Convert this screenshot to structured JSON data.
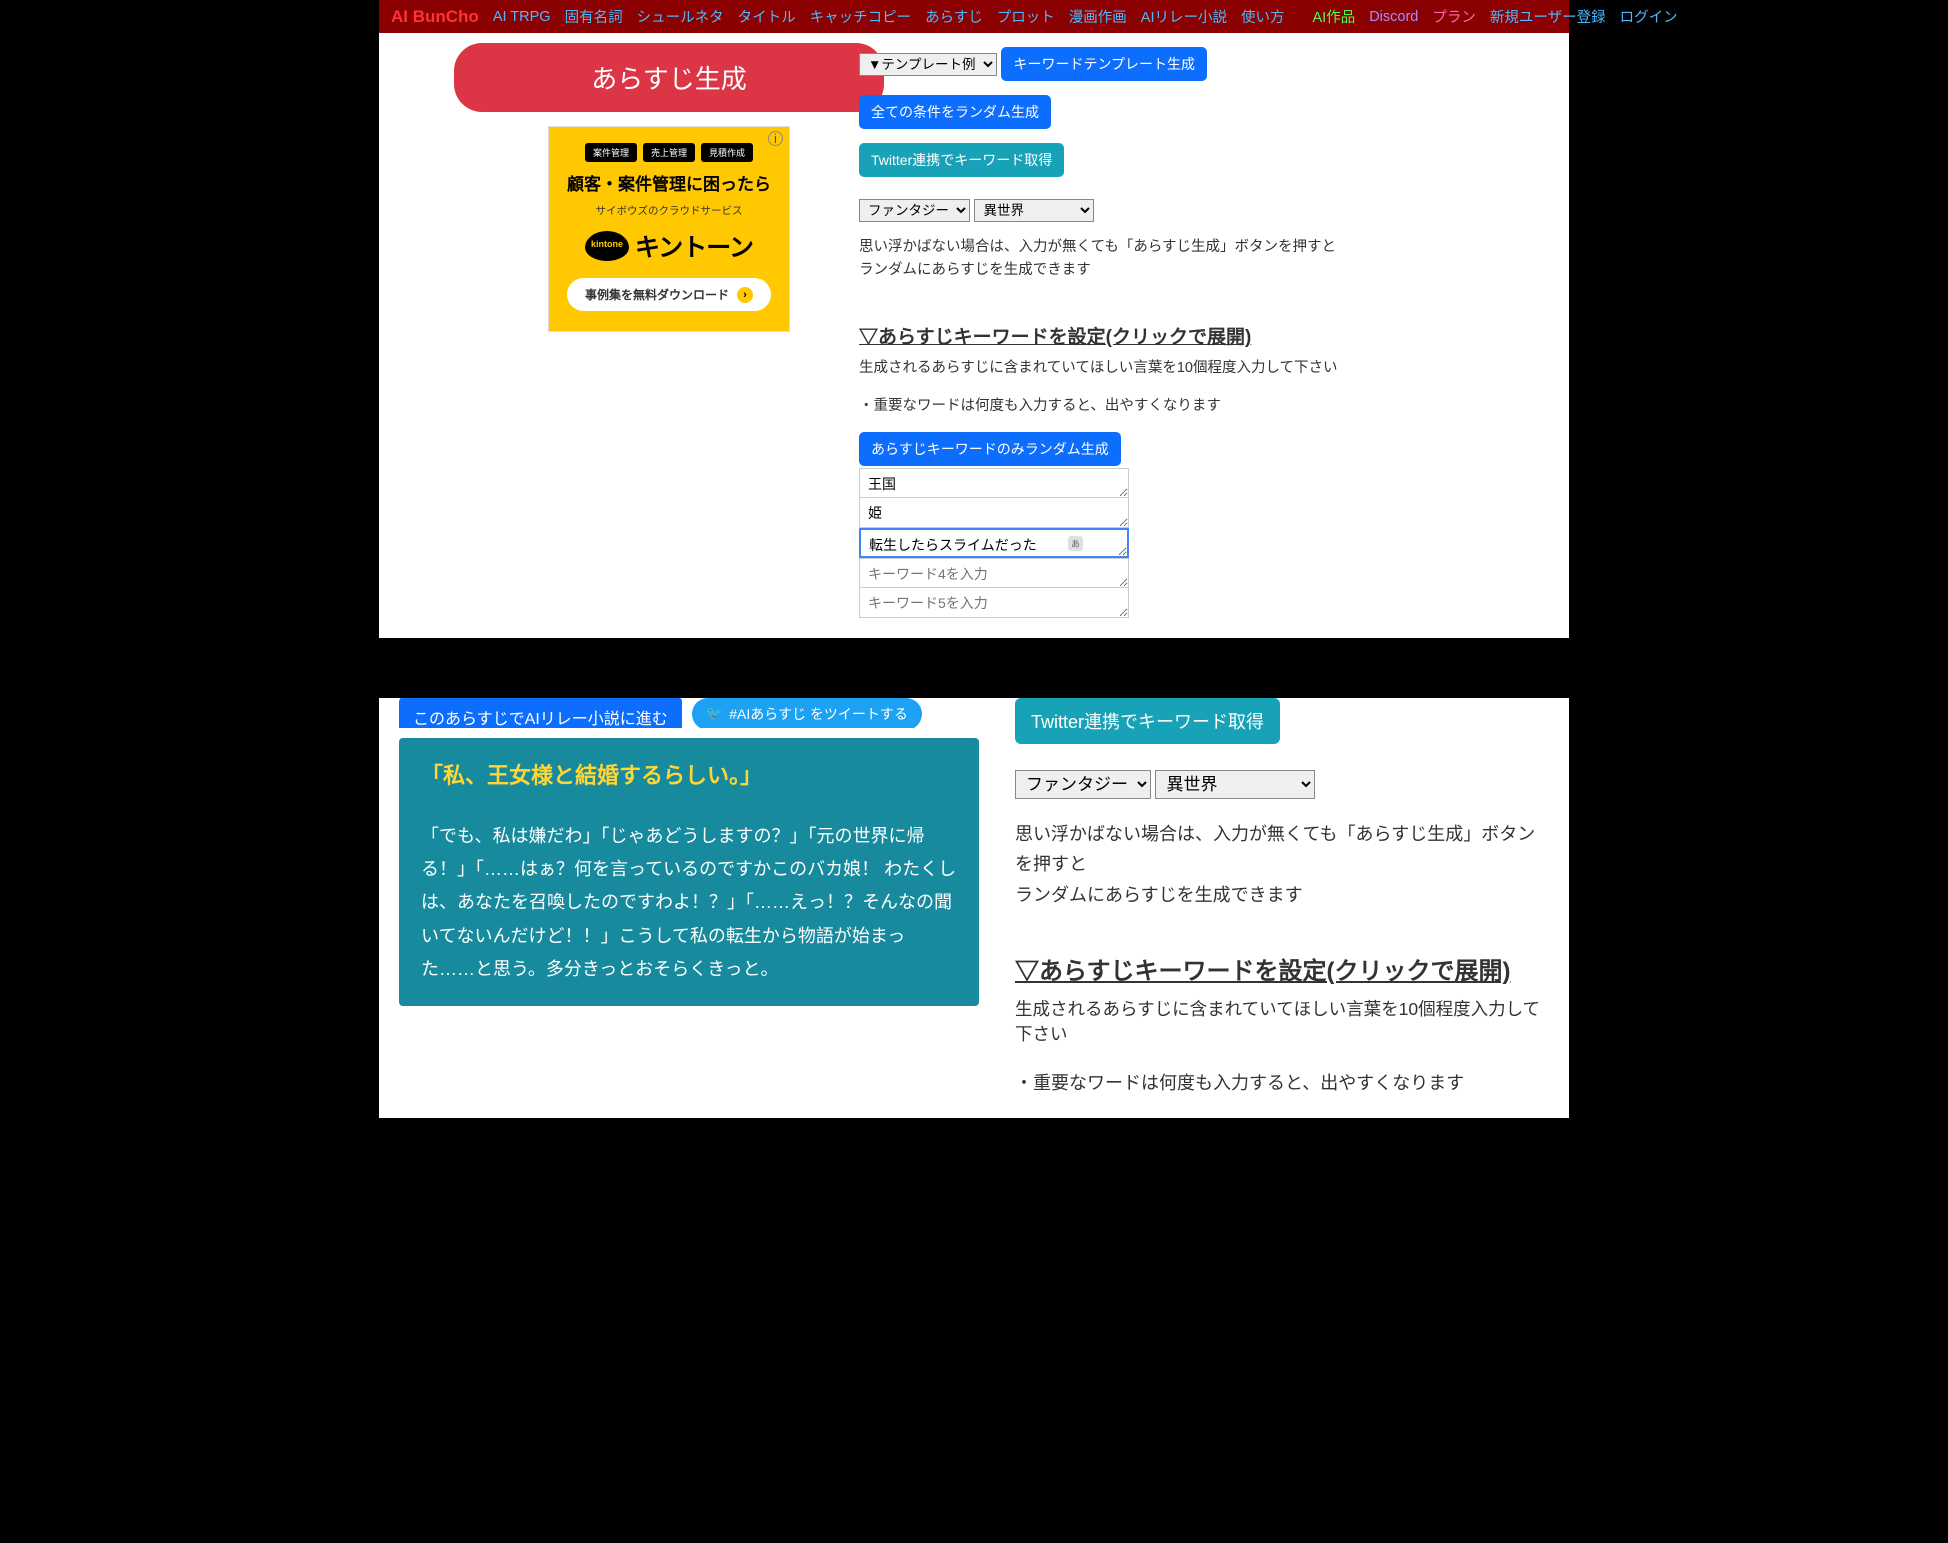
{
  "nav": {
    "brand": "AI BunCho",
    "items": [
      "AI TRPG",
      "固有名詞",
      "シュールネタ",
      "タイトル",
      "キャッチコピー",
      "あらすじ",
      "プロット",
      "漫画作画",
      "AIリレー小説",
      "使い方"
    ],
    "right": [
      "AI作品",
      "Discord",
      "プラン",
      "新規ユーザー登録",
      "ログイン"
    ]
  },
  "left": {
    "generate": "あらすじ生成",
    "ad": {
      "tags": [
        "案件管理",
        "売上管理",
        "見積作成"
      ],
      "headline": "顧客・案件管理に困ったら",
      "sub": "サイボウズのクラウドサービス",
      "logo_badge": "kintone",
      "logo_text": "キントーン",
      "cta": "事例集を無料ダウンロード"
    }
  },
  "right": {
    "template_select": "▼テンプレート例",
    "btn_keyword_template": "キーワードテンプレート生成",
    "btn_random_all": "全ての条件をランダム生成",
    "btn_twitter": "Twitter連携でキーワード取得",
    "genre_select": "ファンタジー",
    "world_select": "異世界",
    "help1": "思い浮かばない場合は、入力が無くても「あらすじ生成」ボタンを押すと",
    "help2": "ランダムにあらすじを生成できます",
    "kw_heading": "▽あらすじキーワードを設定(クリックで展開)",
    "kw_desc": "生成されるあらすじに含まれていてほしい言葉を10個程度入力して下さい",
    "kw_note": "・重要なワードは何度も入力すると、出やすくなります",
    "btn_kw_random": "あらすじキーワードのみランダム生成",
    "kw1": "王国",
    "kw2": "姫",
    "kw3": "転生したらスライムだった",
    "kw4_ph": "キーワード4を入力",
    "kw5_ph": "キーワード5を入力"
  },
  "bottom": {
    "proceed": "このあらすじでAIリレー小説に進む",
    "tweet": "#AIあらすじ をツイートする",
    "story_title": "「私、王女様と結婚するらしい。」",
    "story_body": "「でも、私は嫌だわ」「じゃあどうしますの？」「元の世界に帰る！」「……はぁ？何を言っているのですかこのバカ娘！ わたくしは、あなたを召喚したのですわよ！？」「……えっ！？そんなの聞いてないんだけど！！」こうして私の転生から物語が始まった……と思う。多分きっとおそらくきっと。",
    "btn_twitter": "Twitter連携でキーワード取得",
    "genre_select": "ファンタジー",
    "world_select": "異世界",
    "help1": "思い浮かばない場合は、入力が無くても「あらすじ生成」ボタンを押すと",
    "help2": "ランダムにあらすじを生成できます",
    "kw_heading": "▽あらすじキーワードを設定(クリックで展開)",
    "kw_desc": "生成されるあらすじに含まれていてほしい言葉を10個程度入力して下さい",
    "kw_note": "・重要なワードは何度も入力すると、出やすくなります"
  }
}
